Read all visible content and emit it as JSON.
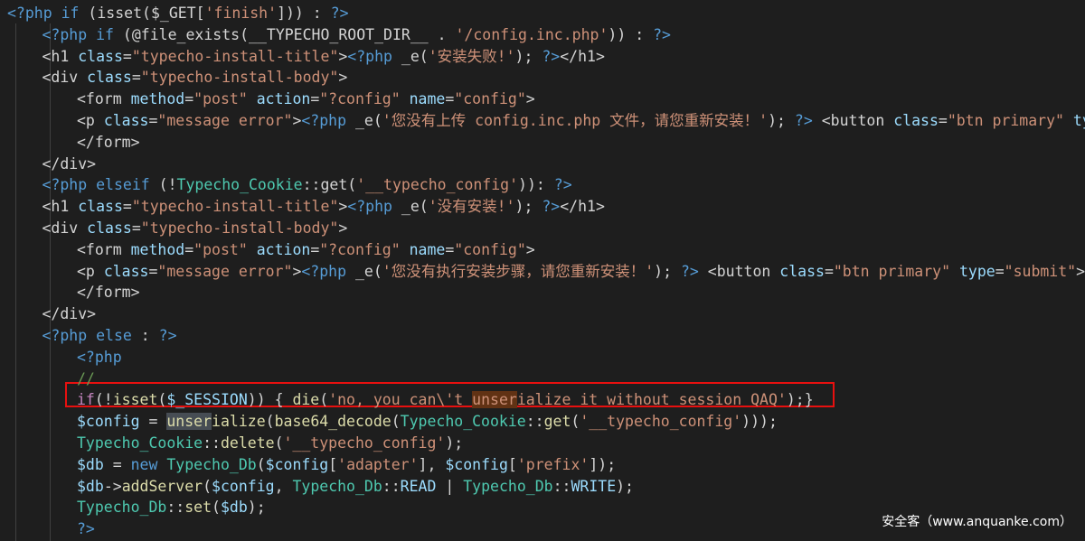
{
  "colors": {
    "background": "#1e1e1e",
    "default": "#d4d4d4",
    "keyword": "#569cd6",
    "control": "#c586c0",
    "string": "#ce9178",
    "function": "#dcdcaa",
    "variable": "#9cdcfe",
    "class": "#4ec9b0",
    "comment": "#6a9955",
    "tag": "#569cd6",
    "attr": "#9cdcfe",
    "php_tag": "#569cd6",
    "highlight_box": "#e8100f"
  },
  "code_lines": [
    {
      "indent": 0,
      "tokens": [
        [
          "<?php ",
          "kw"
        ],
        [
          "if",
          "kw"
        ],
        [
          " (",
          "d"
        ],
        [
          "isset",
          "d"
        ],
        [
          "($_GET[",
          "d"
        ],
        [
          "'finish'",
          "s"
        ],
        [
          "])) : ",
          "d"
        ],
        [
          "?>",
          "kw"
        ]
      ]
    },
    {
      "indent": 1,
      "tokens": [
        [
          "<?php ",
          "kw"
        ],
        [
          "if",
          "kw"
        ],
        [
          " (",
          "d"
        ],
        [
          "@file_exists",
          "d"
        ],
        [
          "(__TYPECHO_ROOT_DIR__ . ",
          "d"
        ],
        [
          "'/config.inc.php'",
          "s"
        ],
        [
          ")) : ",
          "d"
        ],
        [
          "?>",
          "kw"
        ]
      ]
    },
    {
      "indent": 1,
      "tokens": [
        [
          "<h1 ",
          "d"
        ],
        [
          "class",
          "a"
        ],
        [
          "=",
          "d"
        ],
        [
          "\"typecho-install-title\"",
          "s"
        ],
        [
          ">",
          "d"
        ],
        [
          "<?php ",
          "kw"
        ],
        [
          "_e(",
          "d"
        ],
        [
          "'安装失败!'",
          "s"
        ],
        [
          "); ",
          "d"
        ],
        [
          "?>",
          "kw"
        ],
        [
          "</h1>",
          "d"
        ]
      ]
    },
    {
      "indent": 1,
      "tokens": [
        [
          "<div ",
          "d"
        ],
        [
          "class",
          "a"
        ],
        [
          "=",
          "d"
        ],
        [
          "\"typecho-install-body\"",
          "s"
        ],
        [
          ">",
          "d"
        ]
      ]
    },
    {
      "indent": 2,
      "tokens": [
        [
          "<form ",
          "d"
        ],
        [
          "method",
          "a"
        ],
        [
          "=",
          "d"
        ],
        [
          "\"post\"",
          "s"
        ],
        [
          " ",
          "d"
        ],
        [
          "action",
          "a"
        ],
        [
          "=",
          "d"
        ],
        [
          "\"?config\"",
          "s"
        ],
        [
          " ",
          "d"
        ],
        [
          "name",
          "a"
        ],
        [
          "=",
          "d"
        ],
        [
          "\"config\"",
          "s"
        ],
        [
          ">",
          "d"
        ]
      ]
    },
    {
      "indent": 2,
      "tokens": [
        [
          "<p ",
          "d"
        ],
        [
          "class",
          "a"
        ],
        [
          "=",
          "d"
        ],
        [
          "\"message error\"",
          "s"
        ],
        [
          ">",
          "d"
        ],
        [
          "<?php ",
          "kw"
        ],
        [
          "_e(",
          "d"
        ],
        [
          "'您没有上传 config.inc.php 文件，请您重新安装！'",
          "s"
        ],
        [
          "); ",
          "d"
        ],
        [
          "?>",
          "kw"
        ],
        [
          " <button ",
          "d"
        ],
        [
          "class",
          "a"
        ],
        [
          "=",
          "d"
        ],
        [
          "\"btn primary\"",
          "s"
        ],
        [
          " ty",
          "a"
        ]
      ]
    },
    {
      "indent": 2,
      "tokens": [
        [
          "</form>",
          "d"
        ]
      ]
    },
    {
      "indent": 1,
      "tokens": [
        [
          "</div>",
          "d"
        ]
      ]
    },
    {
      "indent": 1,
      "tokens": [
        [
          "<?php ",
          "kw"
        ],
        [
          "elseif",
          "kw"
        ],
        [
          " (!",
          "d"
        ],
        [
          "Typecho_Cookie",
          "c"
        ],
        [
          "::",
          "d"
        ],
        [
          "get(",
          "d"
        ],
        [
          "'__typecho_config'",
          "s"
        ],
        [
          ")): ",
          "d"
        ],
        [
          "?>",
          "kw"
        ]
      ]
    },
    {
      "indent": 1,
      "tokens": [
        [
          "<h1 ",
          "d"
        ],
        [
          "class",
          "a"
        ],
        [
          "=",
          "d"
        ],
        [
          "\"typecho-install-title\"",
          "s"
        ],
        [
          ">",
          "d"
        ],
        [
          "<?php ",
          "kw"
        ],
        [
          "_e(",
          "d"
        ],
        [
          "'没有安装!'",
          "s"
        ],
        [
          "); ",
          "d"
        ],
        [
          "?>",
          "kw"
        ],
        [
          "</h1>",
          "d"
        ]
      ]
    },
    {
      "indent": 1,
      "tokens": [
        [
          "<div ",
          "d"
        ],
        [
          "class",
          "a"
        ],
        [
          "=",
          "d"
        ],
        [
          "\"typecho-install-body\"",
          "s"
        ],
        [
          ">",
          "d"
        ]
      ]
    },
    {
      "indent": 2,
      "tokens": [
        [
          "<form ",
          "d"
        ],
        [
          "method",
          "a"
        ],
        [
          "=",
          "d"
        ],
        [
          "\"post\"",
          "s"
        ],
        [
          " ",
          "d"
        ],
        [
          "action",
          "a"
        ],
        [
          "=",
          "d"
        ],
        [
          "\"?config\"",
          "s"
        ],
        [
          " ",
          "d"
        ],
        [
          "name",
          "a"
        ],
        [
          "=",
          "d"
        ],
        [
          "\"config\"",
          "s"
        ],
        [
          ">",
          "d"
        ]
      ]
    },
    {
      "indent": 2,
      "tokens": [
        [
          "<p ",
          "d"
        ],
        [
          "class",
          "a"
        ],
        [
          "=",
          "d"
        ],
        [
          "\"message error\"",
          "s"
        ],
        [
          ">",
          "d"
        ],
        [
          "<?php ",
          "kw"
        ],
        [
          "_e(",
          "d"
        ],
        [
          "'您没有执行安装步骤，请您重新安装！'",
          "s"
        ],
        [
          "); ",
          "d"
        ],
        [
          "?>",
          "kw"
        ],
        [
          " <button ",
          "d"
        ],
        [
          "class",
          "a"
        ],
        [
          "=",
          "d"
        ],
        [
          "\"btn primary\"",
          "s"
        ],
        [
          " ",
          "d"
        ],
        [
          "type",
          "a"
        ],
        [
          "=",
          "d"
        ],
        [
          "\"submit\"",
          "s"
        ],
        [
          ">",
          "d"
        ]
      ]
    },
    {
      "indent": 2,
      "tokens": [
        [
          "</form>",
          "d"
        ]
      ]
    },
    {
      "indent": 1,
      "tokens": [
        [
          "</div>",
          "d"
        ]
      ]
    },
    {
      "indent": 1,
      "tokens": [
        [
          "<?php ",
          "kw"
        ],
        [
          "else",
          "kw"
        ],
        [
          " : ",
          "d"
        ],
        [
          "?>",
          "kw"
        ]
      ]
    },
    {
      "indent": 2,
      "tokens": [
        [
          "<?php",
          "kw"
        ]
      ]
    },
    {
      "indent": 2,
      "tokens": [
        [
          "//",
          "cm"
        ]
      ]
    },
    {
      "indent": 2,
      "tokens": [
        [
          "if",
          "ctl"
        ],
        [
          "(!",
          "d"
        ],
        [
          "isset",
          "f"
        ],
        [
          "(",
          "d"
        ],
        [
          "$_SESSION",
          "v"
        ],
        [
          ")) { ",
          "d"
        ],
        [
          "die",
          "f"
        ],
        [
          "(",
          "d"
        ],
        [
          "'no, you can\\'t ",
          "s"
        ],
        [
          "unser",
          "su"
        ],
        [
          "ialize it without session QAQ'",
          "s"
        ],
        [
          ");}",
          "d"
        ]
      ]
    },
    {
      "indent": 2,
      "tokens": [
        [
          "$config",
          "v"
        ],
        [
          " = ",
          "d"
        ],
        [
          "unser",
          "fu"
        ],
        [
          "ialize",
          "f"
        ],
        [
          "(",
          "d"
        ],
        [
          "base64_decode",
          "f"
        ],
        [
          "(",
          "d"
        ],
        [
          "Typecho_Cookie",
          "c"
        ],
        [
          "::",
          "d"
        ],
        [
          "get",
          "f"
        ],
        [
          "(",
          "d"
        ],
        [
          "'__typecho_config'",
          "s"
        ],
        [
          ")));",
          "d"
        ]
      ]
    },
    {
      "indent": 2,
      "tokens": [
        [
          "Typecho_Cookie",
          "c"
        ],
        [
          "::",
          "d"
        ],
        [
          "delete",
          "f"
        ],
        [
          "(",
          "d"
        ],
        [
          "'__typecho_config'",
          "s"
        ],
        [
          ");",
          "d"
        ]
      ]
    },
    {
      "indent": 2,
      "tokens": [
        [
          "$db",
          "v"
        ],
        [
          " = ",
          "d"
        ],
        [
          "new",
          "kw"
        ],
        [
          " ",
          "d"
        ],
        [
          "Typecho_Db",
          "c"
        ],
        [
          "(",
          "d"
        ],
        [
          "$config",
          "v"
        ],
        [
          "[",
          "d"
        ],
        [
          "'adapter'",
          "s"
        ],
        [
          "], ",
          "d"
        ],
        [
          "$config",
          "v"
        ],
        [
          "[",
          "d"
        ],
        [
          "'prefix'",
          "s"
        ],
        [
          "]);",
          "d"
        ]
      ]
    },
    {
      "indent": 2,
      "tokens": [
        [
          "$db",
          "v"
        ],
        [
          "->",
          "d"
        ],
        [
          "addServer",
          "f"
        ],
        [
          "(",
          "d"
        ],
        [
          "$config",
          "v"
        ],
        [
          ", ",
          "d"
        ],
        [
          "Typecho_Db",
          "c"
        ],
        [
          "::",
          "d"
        ],
        [
          "READ",
          "v"
        ],
        [
          " | ",
          "d"
        ],
        [
          "Typecho_Db",
          "c"
        ],
        [
          "::",
          "d"
        ],
        [
          "WRITE",
          "v"
        ],
        [
          ");",
          "d"
        ]
      ]
    },
    {
      "indent": 2,
      "tokens": [
        [
          "Typecho_Db",
          "c"
        ],
        [
          "::",
          "d"
        ],
        [
          "set",
          "f"
        ],
        [
          "(",
          "d"
        ],
        [
          "$db",
          "v"
        ],
        [
          ");",
          "d"
        ]
      ]
    },
    {
      "indent": 2,
      "tokens": [
        [
          "?>",
          "kw"
        ]
      ]
    }
  ],
  "watermark": "安全客（www.anquanke.com）"
}
